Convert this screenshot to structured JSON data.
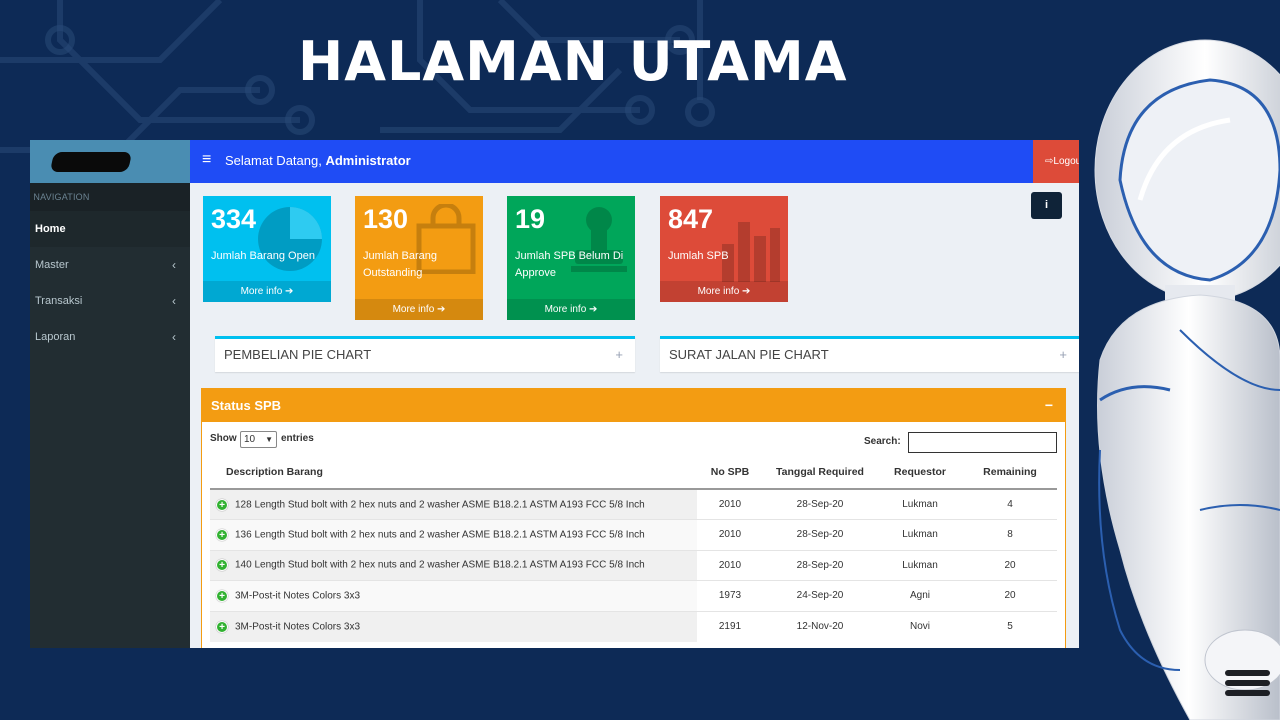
{
  "slide": {
    "title": "HALAMAN UTAMA"
  },
  "sidebar": {
    "nav_header": "N NAVIGATION",
    "items": [
      {
        "label": "Home",
        "active": true
      },
      {
        "label": "Master",
        "chevron": "‹"
      },
      {
        "label": "Transaksi",
        "chevron": "‹"
      },
      {
        "label": "Laporan",
        "chevron": "‹"
      }
    ]
  },
  "topbar": {
    "menu_icon": "≡",
    "welcome_prefix": "Selamat Datang,",
    "user": "Administrator",
    "logout_label": "⇨Logout",
    "info_icon": "i"
  },
  "stats": [
    {
      "value": "334",
      "label": "Jumlah Barang Open",
      "more": "More info ➔",
      "color": "#00c0ef",
      "icon": "pie-chart-icon"
    },
    {
      "value": "130",
      "label": "Jumlah Barang Outstanding",
      "more": "More info ➔",
      "color": "#f39c12",
      "icon": "shopping-bag-icon"
    },
    {
      "value": "19",
      "label": "Jumlah SPB Belum Di Approve",
      "more": "More info ➔",
      "color": "#00a65a",
      "icon": "stamp-icon"
    },
    {
      "value": "847",
      "label": "Jumlah SPB",
      "more": "More info ➔",
      "color": "#dd4b39",
      "icon": "bar-chart-icon"
    }
  ],
  "panels": {
    "pembelian": {
      "title": "PEMBELIAN PIE CHART",
      "toggle": "+"
    },
    "surat": {
      "title": "SURAT JALAN PIE CHART",
      "toggle": "+"
    }
  },
  "status_spb": {
    "title": "Status SPB",
    "toggle": "−",
    "show_label": "Show",
    "entries_value": "10",
    "entries_label": "entries",
    "search_label": "Search:",
    "search_value": "",
    "columns": [
      "Description Barang",
      "No SPB",
      "Tanggal Required",
      "Requestor",
      "Remaining"
    ],
    "rows": [
      [
        "128 Length Stud bolt with 2 hex nuts and 2 washer ASME B18.2.1 ASTM A193 FCC 5/8 Inch",
        "2010",
        "28-Sep-20",
        "Lukman",
        "4"
      ],
      [
        "136 Length Stud bolt with 2 hex nuts and 2 washer ASME B18.2.1 ASTM A193 FCC 5/8 Inch",
        "2010",
        "28-Sep-20",
        "Lukman",
        "8"
      ],
      [
        "140 Length Stud bolt with 2 hex nuts and 2 washer ASME B18.2.1 ASTM A193 FCC 5/8 Inch",
        "2010",
        "28-Sep-20",
        "Lukman",
        "20"
      ],
      [
        "3M-Post-it Notes Colors 3x3",
        "1973",
        "24-Sep-20",
        "Agni",
        "20"
      ],
      [
        "3M-Post-it Notes Colors 3x3",
        "2191",
        "12-Nov-20",
        "Novi",
        "5"
      ]
    ]
  }
}
